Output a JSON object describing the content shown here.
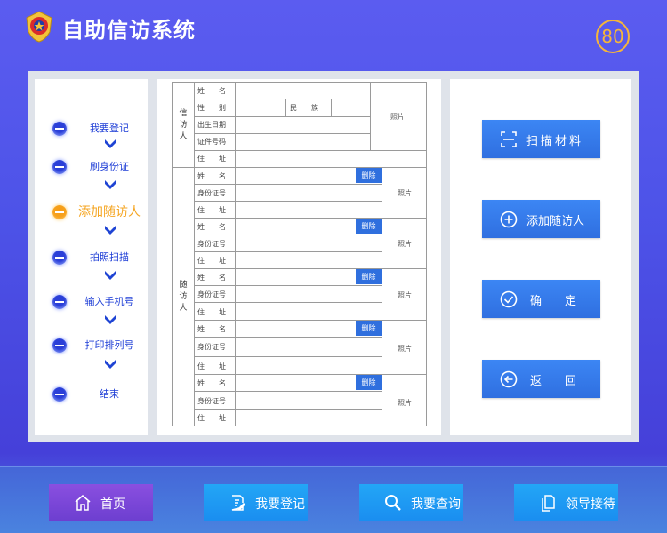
{
  "header": {
    "title": "自助信访系统",
    "countdown": "80"
  },
  "steps": [
    {
      "label": "我要登记",
      "active": false
    },
    {
      "label": "刷身份证",
      "active": false
    },
    {
      "label": "添加随访人",
      "active": true
    },
    {
      "label": "拍照扫描",
      "active": false
    },
    {
      "label": "输入手机号",
      "active": false
    },
    {
      "label": "打印排列号",
      "active": false
    },
    {
      "label": "结束",
      "active": false
    }
  ],
  "form": {
    "petitioner_group": "信访人",
    "companion_group": "随访人",
    "petitioner_fields": {
      "name": "姓　　名",
      "gender": "性　　别",
      "ethnicity": "民　　族",
      "birth_date": "出生日期",
      "id_number": "证件号码",
      "address": "住　　址",
      "photo": "照片"
    },
    "companion_fields": {
      "name": "姓　　名",
      "id_card": "身份证号",
      "address": "住　　址",
      "photo": "照片",
      "delete": "删除"
    },
    "companion_count": 5
  },
  "actions": {
    "scan": "扫描材料",
    "add_companion": "添加随访人",
    "confirm": "确定",
    "back": "返回"
  },
  "nav": {
    "home": "首页",
    "register": "我要登记",
    "query": "我要查询",
    "reception": "领导接待"
  },
  "colors": {
    "accent": "#2f6fe0",
    "active_step": "#f5a623",
    "step_text": "#1d3dd6",
    "home_button": "#7b47d8",
    "nav_button": "#1e9af3"
  }
}
